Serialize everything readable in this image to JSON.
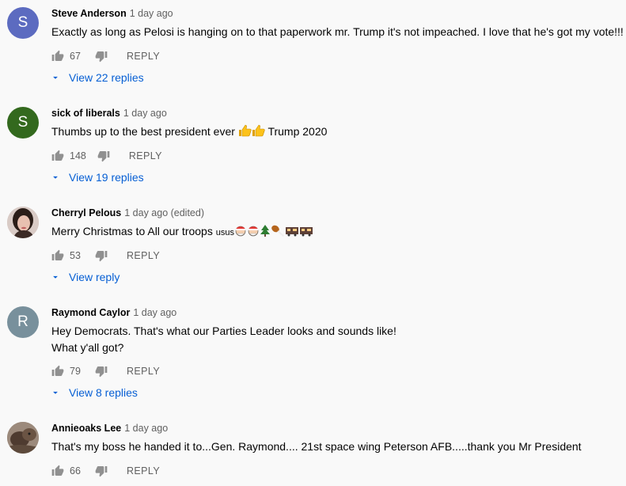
{
  "comments": [
    {
      "author": "Steve Anderson",
      "time": "1 day ago",
      "text": "Exactly as long as Pelosi is hanging on to that paperwork mr. Trump it's not impeached. I love that he's got my vote!!!",
      "likes": "67",
      "reply_label": "REPLY",
      "view_replies": "View 22 replies",
      "avatar_letter": "S",
      "avatar_color": "#5c6bc0"
    },
    {
      "author": "sick of liberals",
      "time": "1 day ago",
      "text_before": "Thumbs up to the best president ever",
      "text_after": "Trump 2020",
      "likes": "148",
      "reply_label": "REPLY",
      "view_replies": "View 19 replies",
      "avatar_letter": "S",
      "avatar_color": "#33691e"
    },
    {
      "author": "Cherryl Pelous",
      "time": "1 day ago (edited)",
      "text_before": "Merry Christmas to All our  troops",
      "text_small": "usus",
      "likes": "53",
      "reply_label": "REPLY",
      "view_replies": "View reply"
    },
    {
      "author": "Raymond Caylor",
      "time": "1 day ago",
      "text_line1": "Hey Democrats. That's what our Parties Leader looks and sounds like!",
      "text_line2": "What y'all got?",
      "likes": "79",
      "reply_label": "REPLY",
      "view_replies": "View 8 replies",
      "avatar_letter": "R",
      "avatar_color": "#78909c"
    },
    {
      "author": "Annieoaks Lee",
      "time": "1 day ago",
      "text": "That's my boss he handed it to...Gen. Raymond.... 21st space wing   Peterson AFB.....thank you Mr  President",
      "likes": "66",
      "reply_label": "REPLY"
    }
  ],
  "icons": {
    "like": "thumbs-up-icon",
    "dislike": "thumbs-down-icon",
    "expand": "chevron-down-icon"
  },
  "colors": {
    "link": "#065fd4",
    "secondary": "#606060",
    "background": "#f9f9f9"
  }
}
